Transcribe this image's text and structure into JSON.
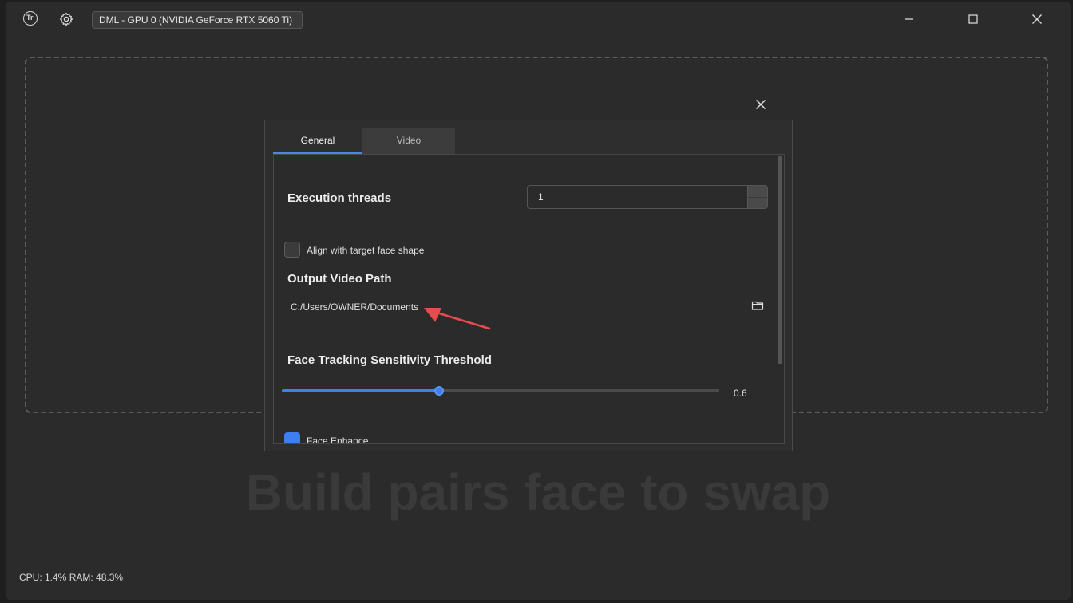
{
  "titlebar": {
    "logo_text": "Tr",
    "device_label": "DML - GPU 0 (NVIDIA GeForce RTX 5060 Ti)"
  },
  "background": {
    "title": "Build pairs face to swap"
  },
  "status": {
    "text": "CPU: 1.4%  RAM: 48.3%"
  },
  "settings": {
    "tabs": [
      {
        "label": "General",
        "active": true
      },
      {
        "label": "Video",
        "active": false
      }
    ],
    "execution_threads": {
      "label": "Execution threads",
      "value": "1"
    },
    "align_face": {
      "label": "Align with target face shape",
      "checked": false
    },
    "output_path": {
      "label": "Output Video Path",
      "value": "C:/Users/OWNER/Documents"
    },
    "tracking": {
      "label": "Face Tracking Sensitivity Threshold",
      "value": "0.6",
      "fraction": 0.36
    },
    "face_enhance": {
      "label": "Face Enhance",
      "checked": true
    }
  },
  "colors": {
    "accent": "#3d7ef0",
    "annotation_arrow": "#e84c4c"
  },
  "icons": [
    "app-logo-icon",
    "gear-icon",
    "minimize-icon",
    "maximize-icon",
    "close-icon",
    "folder-icon"
  ]
}
